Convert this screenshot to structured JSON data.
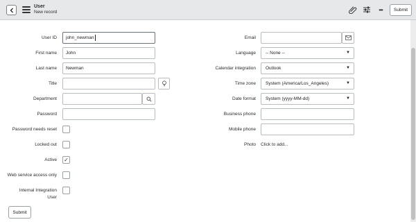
{
  "header": {
    "title": "User",
    "subtitle": "New record",
    "submit_label": "Submit",
    "icons": [
      "back-icon",
      "menu-icon",
      "attachment-icon",
      "settings-sliders-icon",
      "more-options-icon"
    ],
    "more_glyph": "•••"
  },
  "form": {
    "left": {
      "user_id": {
        "label": "User ID",
        "value": "john_newman"
      },
      "first_name": {
        "label": "First name",
        "value": "John"
      },
      "last_name": {
        "label": "Last name",
        "value": "Newman"
      },
      "title": {
        "label": "Title",
        "value": ""
      },
      "department": {
        "label": "Department",
        "value": ""
      },
      "password": {
        "label": "Password",
        "value": ""
      },
      "password_needs_reset": {
        "label": "Password needs reset",
        "checked": false
      },
      "locked_out": {
        "label": "Locked out",
        "checked": false
      },
      "active": {
        "label": "Active",
        "checked": true,
        "check_glyph": "✓"
      },
      "web_service_access_only": {
        "label": "Web service access only",
        "checked": false
      },
      "internal_integration_user": {
        "label_line1": "Internal Integration",
        "label_line2": "User",
        "checked": false
      }
    },
    "right": {
      "email": {
        "label": "Email",
        "value": ""
      },
      "language": {
        "label": "Language",
        "value": "-- None --"
      },
      "calendar_integration": {
        "label": "Calendar integration",
        "value": "Outlook"
      },
      "time_zone": {
        "label": "Time zone",
        "value": "System (America/Los_Angeles)"
      },
      "date_format": {
        "label": "Date format",
        "value": "System (yyyy-MM-dd)"
      },
      "business_phone": {
        "label": "Business phone",
        "value": ""
      },
      "mobile_phone": {
        "label": "Mobile phone",
        "value": ""
      },
      "photo": {
        "label": "Photo",
        "action": "Click to add..."
      }
    },
    "caret_glyph": "▼",
    "submit_label": "Submit"
  },
  "colors": {
    "header_bg": "#e6e8ea",
    "border": "#b9bdc1"
  }
}
